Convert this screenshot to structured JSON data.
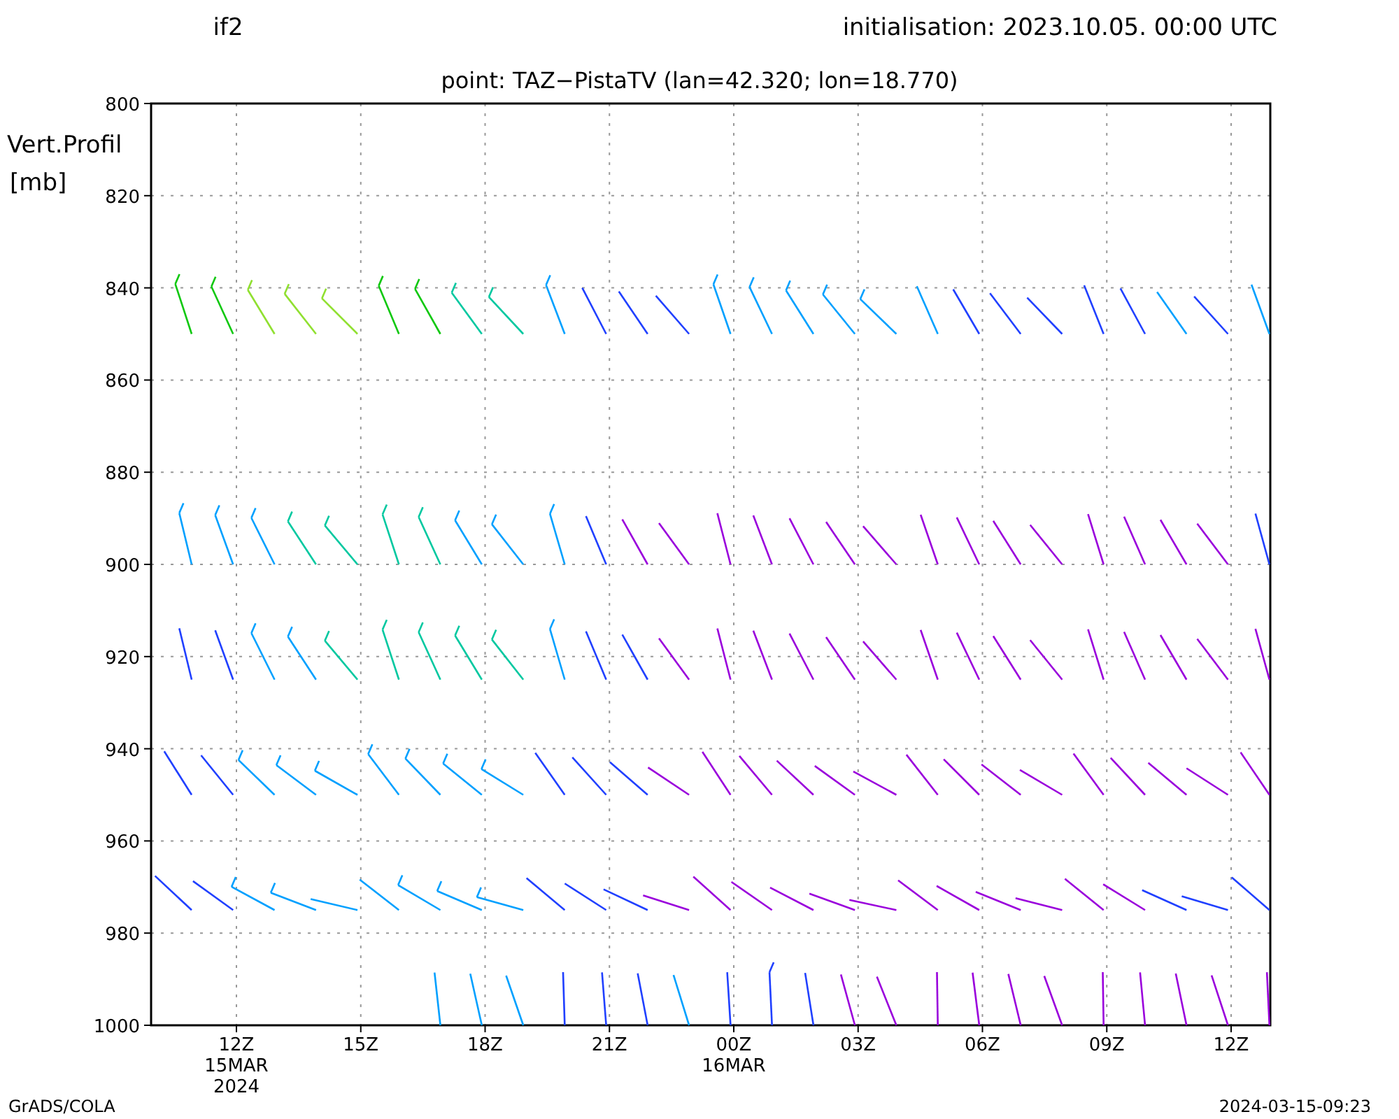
{
  "header": {
    "model": "if2",
    "initialisation": "initialisation:  2023.10.05.  00:00  UTC",
    "point": "point:  TAZ−PistaTV  (lan=42.320;  lon=18.770)"
  },
  "y_axis": {
    "label_lines": [
      "Vert.Profil",
      "[mb]"
    ],
    "ticks": [
      "800",
      "820",
      "840",
      "860",
      "880",
      "900",
      "920",
      "940",
      "960",
      "980",
      "1000"
    ]
  },
  "x_axis": {
    "ticks": [
      {
        "lines": [
          "12Z",
          "15MAR",
          "2024"
        ]
      },
      {
        "lines": [
          "15Z"
        ]
      },
      {
        "lines": [
          "18Z"
        ]
      },
      {
        "lines": [
          "21Z"
        ]
      },
      {
        "lines": [
          "00Z",
          "16MAR"
        ]
      },
      {
        "lines": [
          "03Z"
        ]
      },
      {
        "lines": [
          "06Z"
        ]
      },
      {
        "lines": [
          "09Z"
        ]
      },
      {
        "lines": [
          "12Z"
        ]
      }
    ]
  },
  "footer": {
    "left": "GrADS/COLA",
    "right": "2024-03-15-09:23"
  }
}
